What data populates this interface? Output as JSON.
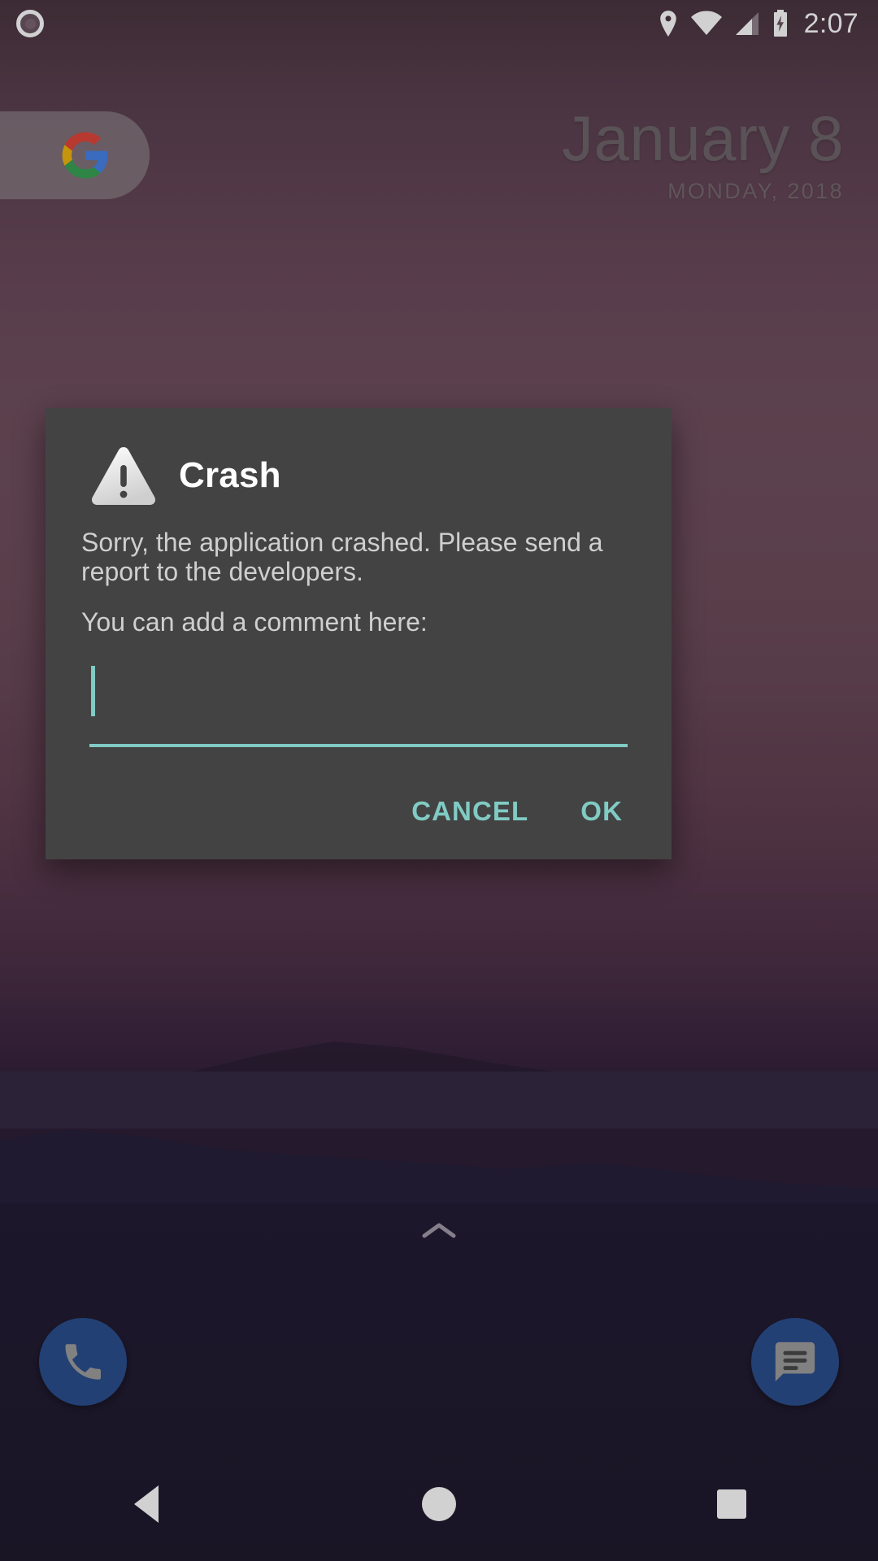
{
  "status_bar": {
    "clock": "2:07",
    "icons": [
      {
        "name": "notification-dot-icon"
      },
      {
        "name": "location-pin-icon"
      },
      {
        "name": "wifi-icon"
      },
      {
        "name": "cell-signal-icon"
      },
      {
        "name": "battery-charging-icon"
      }
    ]
  },
  "home_screen": {
    "search_widget": {
      "logo": "google-g-logo"
    },
    "date_widget": {
      "date": "January 8",
      "subtitle": "MONDAY, 2018"
    },
    "app_drawer": {
      "icon": "chevron-up-icon"
    },
    "dock": [
      {
        "name": "phone-app-icon",
        "label": "Phone"
      },
      {
        "name": "messages-app-icon",
        "label": "Messages"
      }
    ]
  },
  "navigation_bar": {
    "back": "Back",
    "home": "Home",
    "recents": "Recent apps"
  },
  "dialog": {
    "icon": "warning-triangle-icon",
    "title": "Crash",
    "message_1": "Sorry, the application crashed. Please send a report to the developers.",
    "message_2": "You can add a comment here:",
    "comment_input": {
      "value": "",
      "placeholder": ""
    },
    "buttons": {
      "cancel": "CANCEL",
      "ok": "OK"
    }
  },
  "colors": {
    "dialog_background": "#434343",
    "accent_teal": "#80cbc4",
    "dock_blue": "#2b4f8e",
    "status_text": "#ffffff",
    "title_text": "#ffffff",
    "body_text": "#cfcfcf"
  }
}
